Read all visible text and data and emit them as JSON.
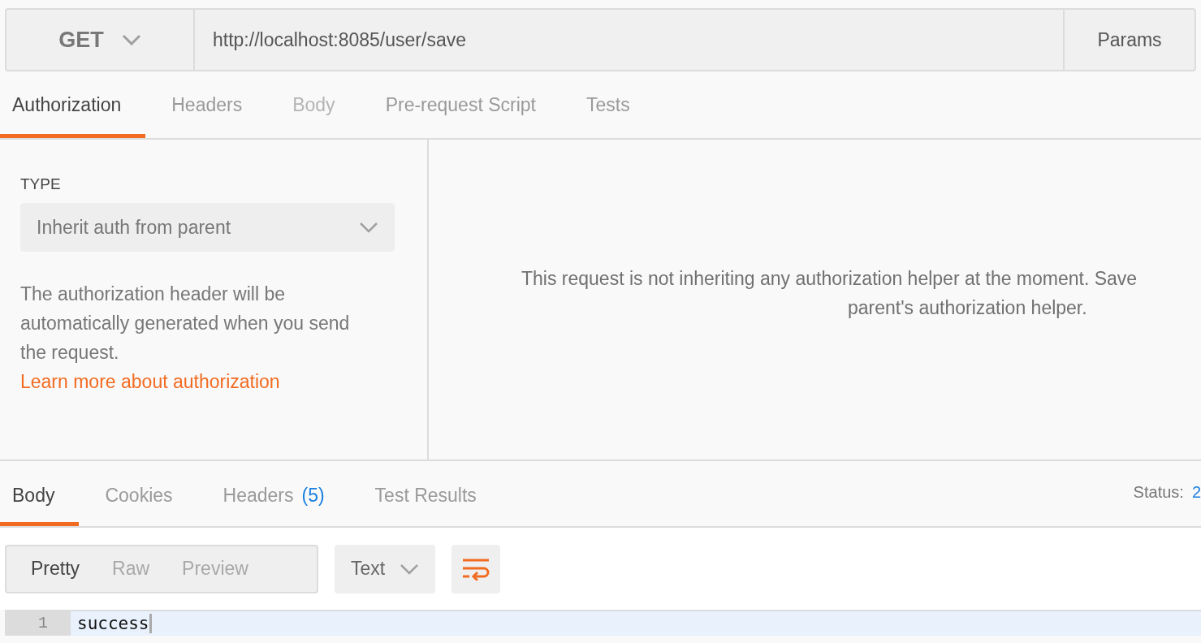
{
  "request_bar": {
    "method": "GET",
    "url": "http://localhost:8085/user/save",
    "params_button": "Params"
  },
  "request_tabs": [
    {
      "label": "Authorization",
      "selected": true,
      "disabled": false
    },
    {
      "label": "Headers",
      "selected": false,
      "disabled": false
    },
    {
      "label": "Body",
      "selected": false,
      "disabled": true
    },
    {
      "label": "Pre-request Script",
      "selected": false,
      "disabled": false
    },
    {
      "label": "Tests",
      "selected": false,
      "disabled": false
    }
  ],
  "auth": {
    "type_label": "TYPE",
    "type_value": "Inherit auth from parent",
    "help_text": "The authorization header will be automatically generated when you send the request. ",
    "help_link": "Learn more about authorization",
    "message_lines": [
      "This request is not inheriting any authorization helper at the moment. Save",
      "parent's authorization helper."
    ]
  },
  "response_tabs": [
    {
      "label": "Body",
      "selected": true
    },
    {
      "label": "Cookies",
      "selected": false
    },
    {
      "label": "Headers",
      "count": "(5)",
      "selected": false
    },
    {
      "label": "Test Results",
      "selected": false
    }
  ],
  "status": {
    "label": "Status:",
    "value": "2"
  },
  "view_modes": [
    {
      "label": "Pretty",
      "selected": true
    },
    {
      "label": "Raw",
      "selected": false
    },
    {
      "label": "Preview",
      "selected": false
    }
  ],
  "format": "Text",
  "code_lines": [
    {
      "number": "1",
      "text": "success"
    }
  ]
}
